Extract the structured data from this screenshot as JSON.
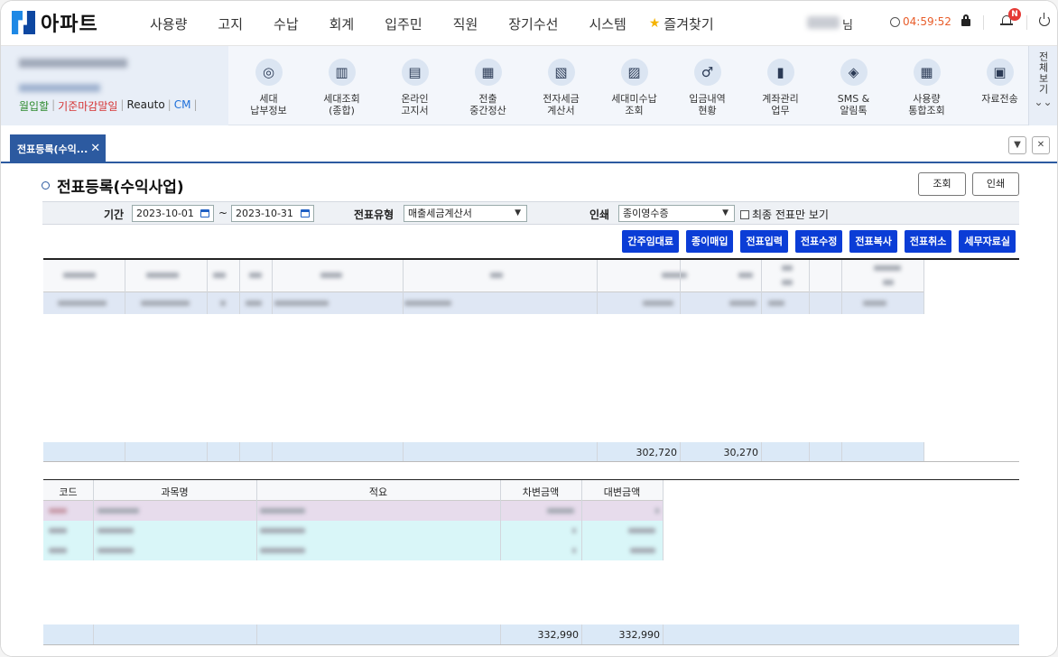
{
  "app": {
    "logo_text": "아파트",
    "user_suffix": "님",
    "timer": "04:59:52",
    "notification_badge": "N"
  },
  "nav": {
    "items": [
      "사용량",
      "고지",
      "수납",
      "회계",
      "입주민",
      "직원",
      "장기수선",
      "시스템"
    ],
    "favorites": "즐겨찾기"
  },
  "profile": {
    "links": [
      "월입할",
      "기준마감말일",
      "Reauto",
      "CM"
    ]
  },
  "quick": [
    {
      "label": "세대\n납부정보",
      "icon": "payment-icon"
    },
    {
      "label": "세대조회\n(종합)",
      "icon": "building-search-icon"
    },
    {
      "label": "온라인\n고지서",
      "icon": "notice-icon"
    },
    {
      "label": "전출\n중간정산",
      "icon": "document-icon"
    },
    {
      "label": "전자세금\n계산서",
      "icon": "tax-invoice-icon"
    },
    {
      "label": "세대미수납\n조회",
      "icon": "unpaid-search-icon"
    },
    {
      "label": "입금내역\n현황",
      "icon": "deposit-icon"
    },
    {
      "label": "계좌관리\n업무",
      "icon": "account-chart-icon"
    },
    {
      "label": "SMS &\n알림톡",
      "icon": "sms-icon"
    },
    {
      "label": "사용량\n통합조회",
      "icon": "usage-icon"
    },
    {
      "label": "자료전송",
      "icon": "save-icon"
    }
  ],
  "allview_label": "전체보기",
  "tab": {
    "label": "전표등록(수익..."
  },
  "page": {
    "title": "전표등록(수익사업)",
    "search_label": "조회",
    "print_label": "인쇄",
    "period_label": "기간",
    "date_from": "2023-10-01",
    "date_to": "2023-10-31",
    "date_sep": "~",
    "type_label": "전표유형",
    "type_value": "매출세금계산서",
    "print_type_label": "인쇄",
    "print_type_value": "종이영수증",
    "latest_only_label": "최종 전표만 보기"
  },
  "actions": [
    "간주임대료",
    "종이매입",
    "전표입력",
    "전표수정",
    "전표복사",
    "전표취소",
    "세무자료실"
  ],
  "grid1": {
    "total_supply": "302,720",
    "total_tax": "30,270"
  },
  "grid2": {
    "headers": [
      "코드",
      "과목명",
      "적요",
      "차변금액",
      "대변금액"
    ],
    "total_debit": "332,990",
    "total_credit": "332,990"
  }
}
